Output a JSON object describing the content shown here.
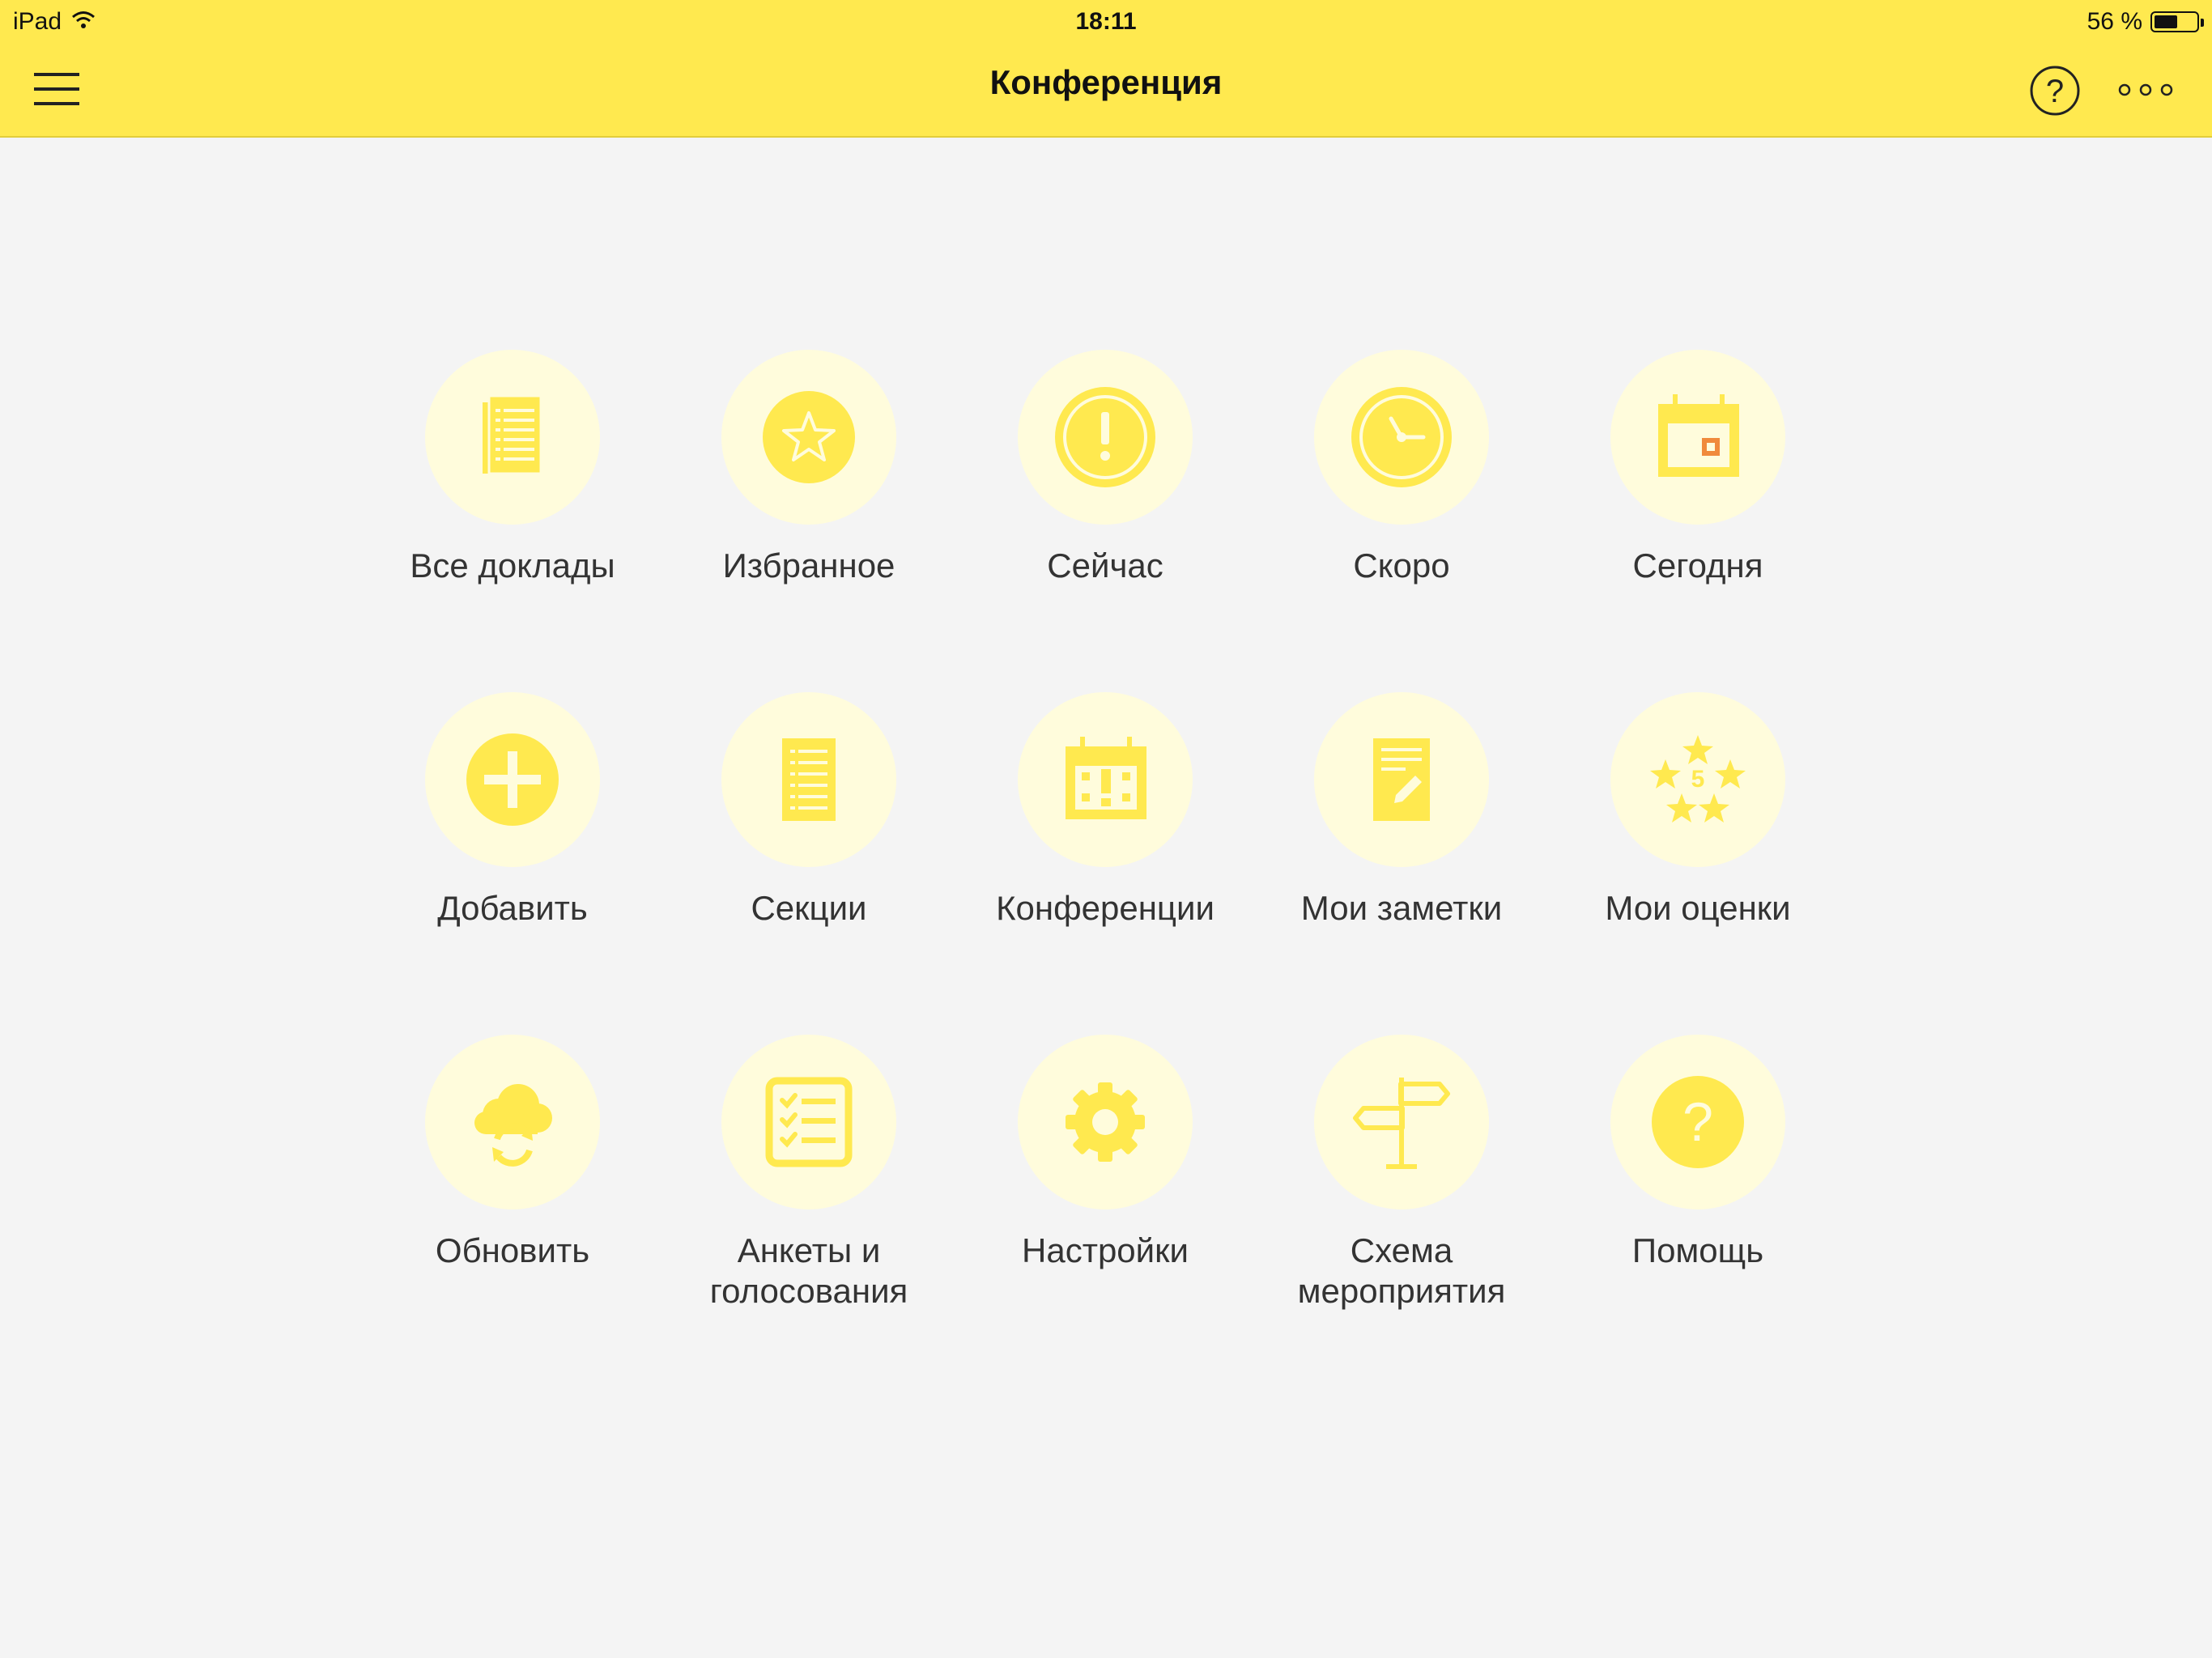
{
  "status_bar": {
    "device": "iPad",
    "time": "18:11",
    "battery_text": "56 %",
    "battery_level": 0.56
  },
  "header": {
    "title": "Конференция",
    "menu_icon": "hamburger-menu-icon",
    "help_icon": "question-circle-icon",
    "more_icon": "more-dots-icon"
  },
  "colors": {
    "header_background": "#ffe94f",
    "page_background": "#f4f4f4",
    "tile_circle": "#fffcdc",
    "icon_yellow": "#ffe94f",
    "icon_accent": "#f08a3c",
    "label_text": "#333333"
  },
  "menu": {
    "items": [
      {
        "label": "Все доклады",
        "icon": "documents-icon"
      },
      {
        "label": "Избранное",
        "icon": "star-icon"
      },
      {
        "label": "Сейчас",
        "icon": "exclamation-icon"
      },
      {
        "label": "Скоро",
        "icon": "clock-icon"
      },
      {
        "label": "Сегодня",
        "icon": "calendar-today-icon"
      },
      {
        "label": "Добавить",
        "icon": "plus-icon"
      },
      {
        "label": "Секции",
        "icon": "list-document-icon"
      },
      {
        "label": "Конференции",
        "icon": "calendar-exclamation-icon"
      },
      {
        "label": "Мои заметки",
        "icon": "notes-icon"
      },
      {
        "label": "Мои оценки",
        "icon": "rating-stars-icon"
      },
      {
        "label": "Обновить",
        "icon": "cloud-sync-icon"
      },
      {
        "label": "Анкеты и голосования",
        "icon": "checklist-icon"
      },
      {
        "label": "Настройки",
        "icon": "gear-icon"
      },
      {
        "label": "Схема мероприятия",
        "icon": "signpost-icon"
      },
      {
        "label": "Помощь",
        "icon": "help-icon"
      }
    ]
  }
}
